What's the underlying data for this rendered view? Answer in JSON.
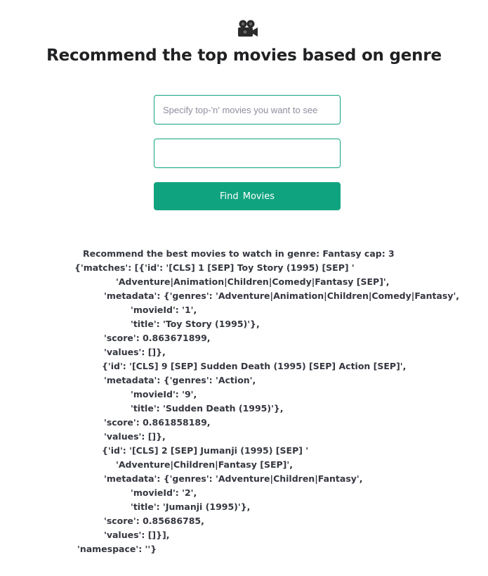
{
  "header": {
    "logo_icon": "movie-camera-icon",
    "title": "Recommend the top movies based on genre"
  },
  "form": {
    "topn_placeholder": "Specify top-'n' movies you want to see",
    "topn_value": "",
    "genre_placeholder": "",
    "genre_value": "",
    "submit_label": "Find  Movies"
  },
  "colors": {
    "accent": "#10a37f",
    "text": "#202123"
  },
  "result": {
    "lines": [
      "Recommend the best movies to watch in genre: Fantasy cap: 3",
      "{'matches': [{'id': '[CLS] 1 [SEP] Toy Story (1995) [SEP] '",
      "'Adventure|Animation|Children|Comedy|Fantasy [SEP]',",
      "'metadata': {'genres': 'Adventure|Animation|Children|Comedy|Fantasy',",
      "'movieId': '1',",
      "'title': 'Toy Story (1995)'},",
      "'score': 0.863671899,",
      "'values': []},",
      "{'id': '[CLS] 9 [SEP] Sudden Death (1995) [SEP] Action [SEP]',",
      "'metadata': {'genres': 'Action',",
      "'movieId': '9',",
      "'title': 'Sudden Death (1995)'},",
      "'score': 0.861858189,",
      "'values': []},",
      "{'id': '[CLS] 2 [SEP] Jumanji (1995) [SEP] '",
      "'Adventure|Children|Fantasy [SEP]',",
      "'metadata': {'genres': 'Adventure|Children|Fantasy',",
      "'movieId': '2',",
      "'title': 'Jumanji (1995)'},",
      "'score': 0.85686785,",
      "'values': []}],",
      "'namespace': ''}"
    ]
  }
}
